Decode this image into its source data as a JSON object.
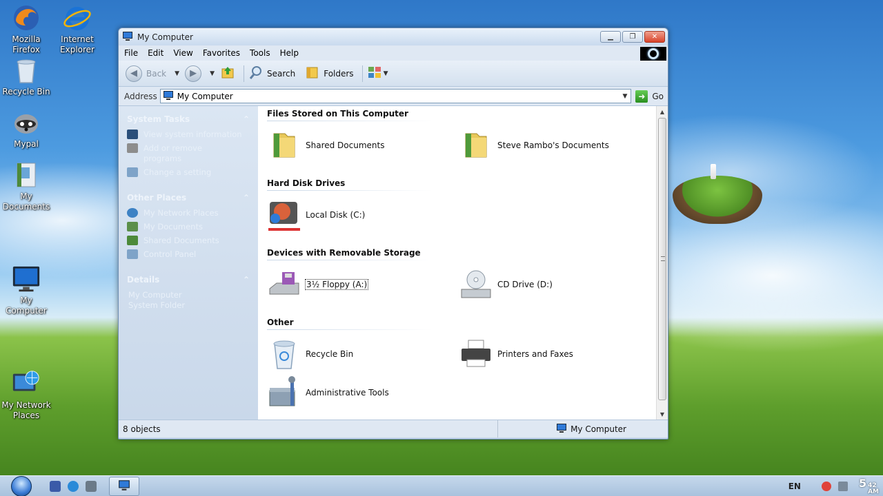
{
  "desktop": {
    "icons": [
      {
        "label": "Mozilla Firefox"
      },
      {
        "label": "Internet Explorer"
      },
      {
        "label": "Recycle Bin"
      },
      {
        "label": "Mypal"
      },
      {
        "label": "My Documents"
      },
      {
        "label": "My Computer"
      },
      {
        "label": "My Network Places"
      }
    ]
  },
  "window": {
    "title": "My Computer",
    "menu": [
      "File",
      "Edit",
      "View",
      "Favorites",
      "Tools",
      "Help"
    ],
    "toolbar": {
      "back_label": "Back",
      "search_label": "Search",
      "folders_label": "Folders"
    },
    "address": {
      "label": "Address",
      "value": "My Computer",
      "go_label": "Go"
    },
    "left_pane": {
      "system_tasks": {
        "header": "System Tasks",
        "items": [
          "View system information",
          "Add or remove programs",
          "Change a setting"
        ]
      },
      "other_places": {
        "header": "Other Places",
        "items": [
          "My Network Places",
          "My Documents",
          "Shared Documents",
          "Control Panel"
        ]
      },
      "details": {
        "header": "Details",
        "line1": "My Computer",
        "line2": "System Folder"
      }
    },
    "sections": [
      {
        "title": "Files Stored on This Computer",
        "items": [
          "Shared Documents",
          "Steve Rambo's Documents"
        ]
      },
      {
        "title": "Hard Disk Drives",
        "items": [
          "Local Disk (C:)"
        ]
      },
      {
        "title": "Devices with Removable Storage",
        "items": [
          "3½ Floppy (A:)",
          "CD Drive (D:)"
        ]
      },
      {
        "title": "Other",
        "items": [
          "Recycle Bin",
          "Printers and Faxes",
          "Administrative Tools"
        ]
      }
    ],
    "status": {
      "left": "8 objects",
      "right": "My Computer"
    }
  },
  "taskbar": {
    "language": "EN",
    "clock_hour": "5",
    "clock_minute": "42",
    "clock_ampm": "AM"
  },
  "colors": {
    "accent": "#3a7bd5",
    "window_frame": "#c7d7ea",
    "taskbar": "#b7cde4"
  }
}
